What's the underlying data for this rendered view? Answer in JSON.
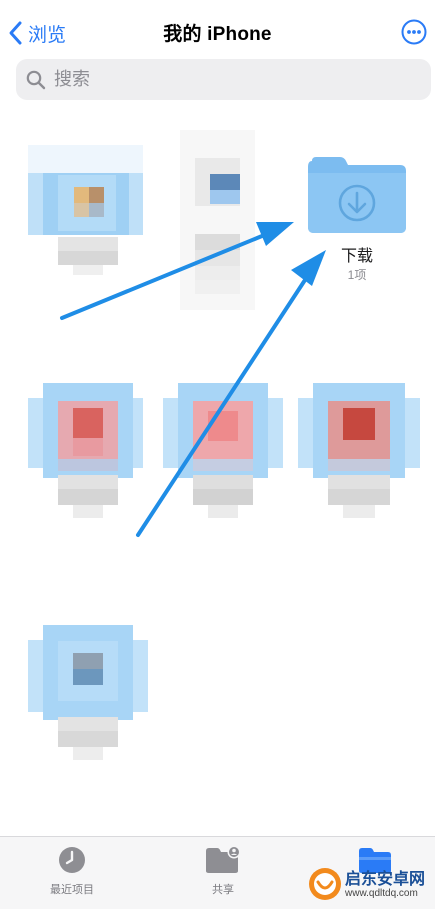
{
  "nav": {
    "back_label": "浏览",
    "title": "我的 iPhone"
  },
  "search": {
    "placeholder": "搜索",
    "value": ""
  },
  "folder": {
    "name": "下载",
    "count": "1项",
    "icon": "download-folder-icon",
    "color": "#7cbcf0"
  },
  "tabs": [
    {
      "label": "最近项目",
      "icon": "clock-icon"
    },
    {
      "label": "共享",
      "icon": "shared-folder-icon"
    },
    {
      "label": "",
      "icon": "folder-icon"
    }
  ],
  "watermark": {
    "text": "启东安卓网",
    "url": "www.qdltdq.com"
  },
  "colors": {
    "accent": "#2a7bf6",
    "arrow": "#1f8de6"
  }
}
